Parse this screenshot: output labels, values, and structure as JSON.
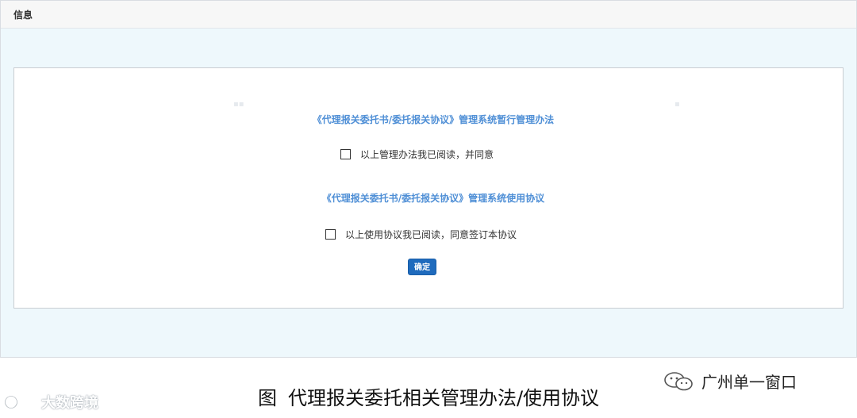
{
  "panel": {
    "title": "信息"
  },
  "agreements": {
    "rules_title": "《代理报关委托书/委托报关协议》管理系统暂行管理办法",
    "rules_agree_label": "以上管理办法我已阅读，并同意",
    "usage_title": "《代理报关委托书/委托报关协议》管理系统使用协议",
    "usage_agree_label": "以上使用协议我已阅读，同意签订本协议",
    "rules_checked": false,
    "usage_checked": false
  },
  "actions": {
    "confirm_label": "确定"
  },
  "caption": {
    "figure_label": "图",
    "text": "代理报关委托相关管理办法/使用协议"
  },
  "watermarks": {
    "left_text": "大数跨境",
    "right_text": "广州单一窗口"
  },
  "colors": {
    "accent_link": "#4f8fd6",
    "confirm_button": "#1f6bbd",
    "page_background": "#eef8fc"
  }
}
